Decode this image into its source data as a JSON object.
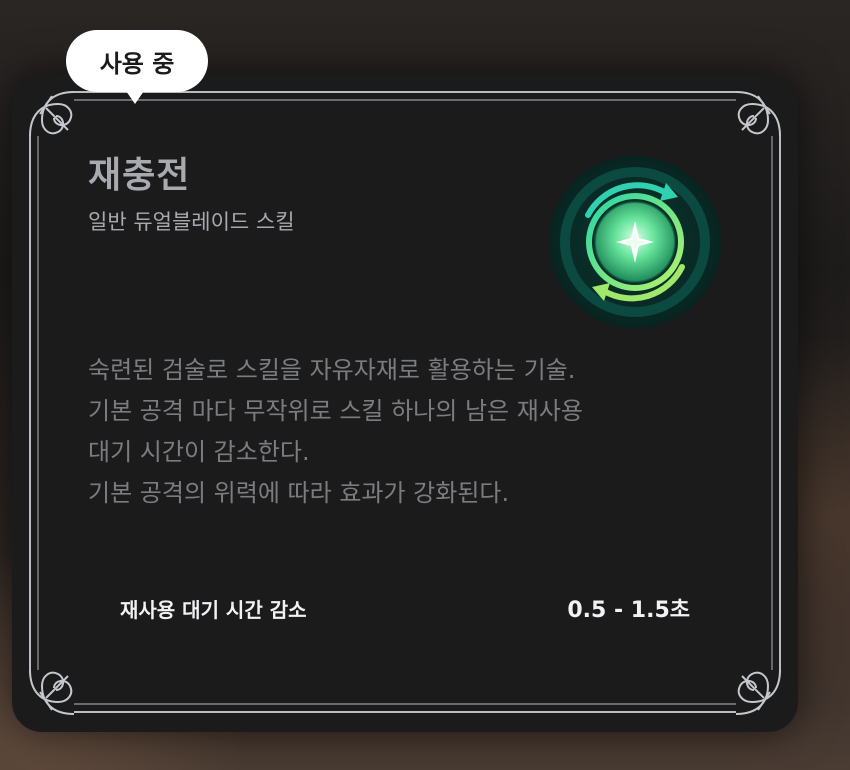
{
  "badge": {
    "label": "사용 중"
  },
  "skill": {
    "name": "재충전",
    "type": "일반 듀얼블레이드 스킬",
    "icon": "recharge-skill-icon",
    "description": [
      "숙련된 검술로 스킬을 자유자재로 활용하는 기술.",
      "기본 공격 마다 무작위로 스킬 하나의 남은 재사용",
      "대기 시간이 감소한다.",
      "기본 공격의 위력에 따라 효과가 강화된다."
    ],
    "stats": [
      {
        "label": "재사용 대기 시간 감소",
        "value": "0.5 - 1.5초"
      }
    ]
  },
  "colors": {
    "panel": "#1b1b1c",
    "title": "#a9aaaf",
    "description": "#7b7c80",
    "stat_text": "#f2f2f4",
    "frame": "#b9bcc2",
    "icon_green": "#37e08f"
  }
}
